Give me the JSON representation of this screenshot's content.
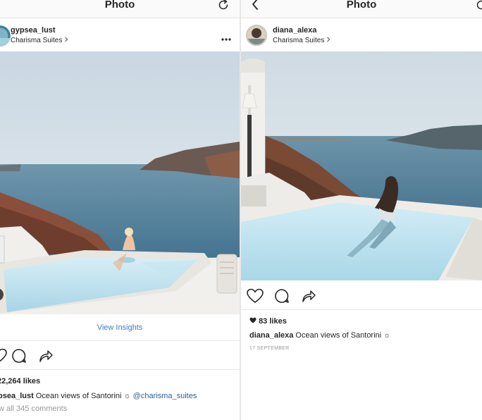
{
  "left_post": {
    "topbar_title": "Photo",
    "username": "gypsea_lust",
    "location": "Charisma Suites",
    "view_insights": "View Insights",
    "likes": "22,264 likes",
    "caption_user": "psea_lust",
    "caption_text": " Ocean views of Santorini ☼ ",
    "caption_mention": "@charisma_suites",
    "comments": "w all 345 comments"
  },
  "right_post": {
    "topbar_title": "Photo",
    "username": "diana_alexa",
    "location": "Charisma Suites",
    "likes": "83 likes",
    "caption_user": "diana_alexa",
    "caption_text": " Ocean views of Santorini ☼",
    "date": "17 SEPTEMBER"
  },
  "icons": {
    "refresh": "refresh-icon",
    "back": "back-arrow-icon",
    "more": "more-options-icon",
    "location_chevron": "chevron-right-icon",
    "like": "heart-icon",
    "comment": "comment-icon",
    "share": "share-icon",
    "likes_heart": "heart-filled-icon"
  },
  "colors": {
    "link_blue": "#3d7ec4",
    "mention_blue": "#2b5f98",
    "text": "#262626",
    "muted": "#999999",
    "pool": "#bfe0ee",
    "sea": "#4e7d99",
    "sky": "#dfe8ef"
  }
}
